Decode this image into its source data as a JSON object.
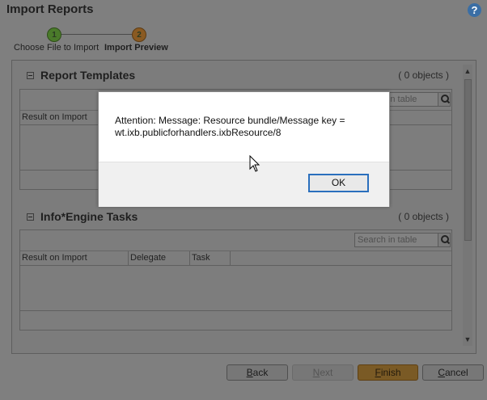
{
  "window": {
    "title": "Import Reports",
    "help_icon": "help-icon",
    "help_glyph": "?"
  },
  "steps": [
    {
      "number": "1",
      "label": "Choose File to Import"
    },
    {
      "number": "2",
      "label": "Import Preview"
    }
  ],
  "sections": {
    "report_templates": {
      "title": "Report Templates",
      "count": "( 0 objects )",
      "search_placeholder": "Search in table",
      "columns": [
        "Result on Import"
      ]
    },
    "infoengine_tasks": {
      "title": "Info*Engine Tasks",
      "count": "( 0 objects )",
      "search_placeholder": "Search in table",
      "columns": [
        "Result on Import",
        "Delegate",
        "Task"
      ]
    }
  },
  "buttons": {
    "back_first": "B",
    "back_rest": "ack",
    "next_first": "N",
    "next_rest": "ext",
    "finish_first": "F",
    "finish_rest": "inish",
    "cancel_first": "C",
    "cancel_rest": "ancel"
  },
  "dialog": {
    "message_line1": "Attention: Message:  Resource bundle/Message key =",
    "message_line2": "wt.ixb.publicforhandlers.ixbResource/8",
    "ok_label": "OK"
  },
  "scrollbar": {
    "up_glyph": "▲",
    "down_glyph": "▼"
  },
  "colors": {
    "dialog_focus": "#2a6fbd",
    "finish_accent": "#d9a43a",
    "overlay": "#7f7f7f"
  }
}
